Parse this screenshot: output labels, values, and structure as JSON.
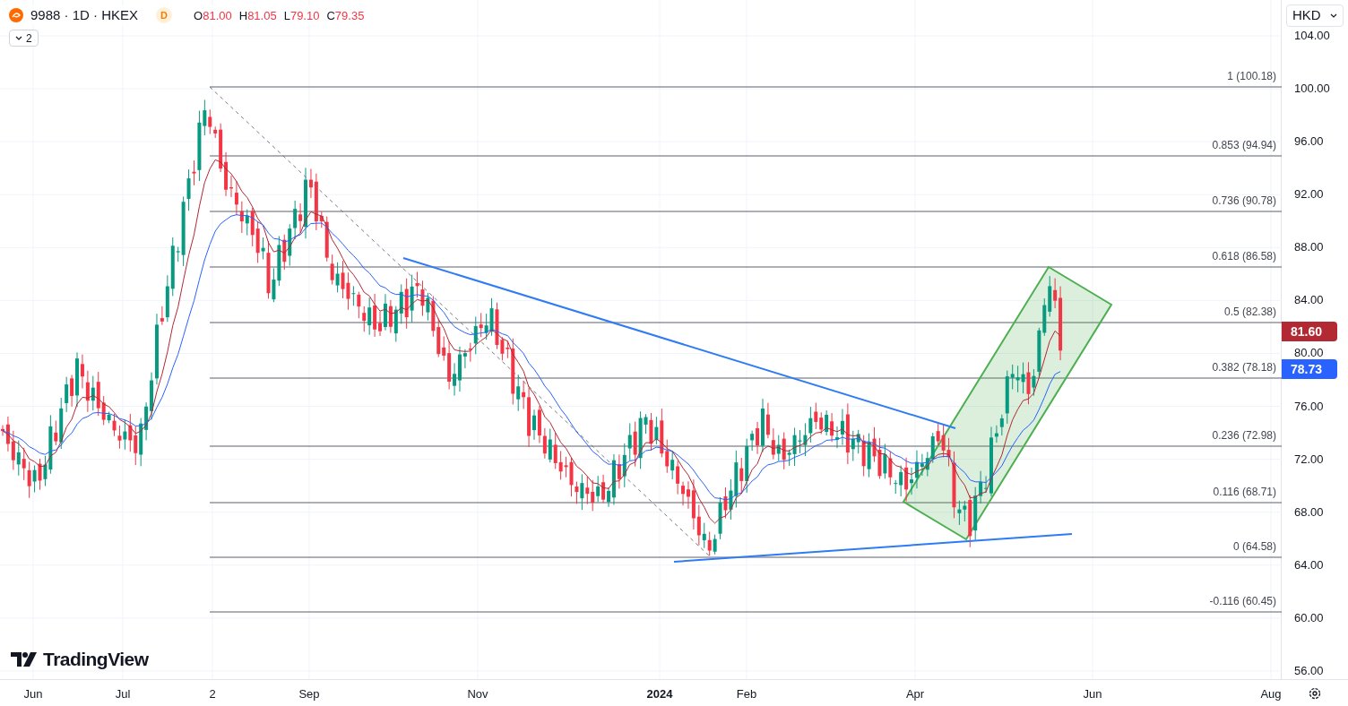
{
  "header": {
    "symbol": "9988 · 1D · HKEX",
    "interval_badge": "D",
    "ohlc": [
      {
        "key": "O",
        "value": "81.00"
      },
      {
        "key": "H",
        "value": "81.05"
      },
      {
        "key": "L",
        "value": "79.10"
      },
      {
        "key": "C",
        "value": "79.35"
      }
    ]
  },
  "indicators_toggle": {
    "count": "2"
  },
  "currency": "HKD",
  "fib_levels": [
    {
      "label": "1 (100.18)"
    },
    {
      "label": "0.853 (94.94)"
    },
    {
      "label": "0.736 (90.78)"
    },
    {
      "label": "0.618 (86.58)"
    },
    {
      "label": "0.5 (82.38)"
    },
    {
      "label": "0.382 (78.18)"
    },
    {
      "label": "0.236 (72.98)"
    },
    {
      "label": "0.116 (68.71)"
    },
    {
      "label": "0 (64.58)"
    },
    {
      "label": "-0.116 (60.45)"
    }
  ],
  "price_axis": [
    "104.00",
    "100.00",
    "96.00",
    "92.00",
    "88.00",
    "84.00",
    "80.00",
    "76.00",
    "72.00",
    "68.00",
    "64.00",
    "60.00",
    "56.00"
  ],
  "price_badges": [
    {
      "value": "81.60",
      "color": "#b22833"
    },
    {
      "value": "78.73",
      "color": "#2962ff"
    }
  ],
  "time_axis": [
    {
      "label": "Jun",
      "kind": "month"
    },
    {
      "label": "Jul",
      "kind": "month"
    },
    {
      "label": "2",
      "kind": "month"
    },
    {
      "label": "Sep",
      "kind": "month"
    },
    {
      "label": "Nov",
      "kind": "month"
    },
    {
      "label": "2024",
      "kind": "year"
    },
    {
      "label": "Feb",
      "kind": "month"
    },
    {
      "label": "Apr",
      "kind": "month"
    },
    {
      "label": "Jun",
      "kind": "month"
    },
    {
      "label": "Aug",
      "kind": "month"
    }
  ],
  "watermark_logo": "TradingView"
}
